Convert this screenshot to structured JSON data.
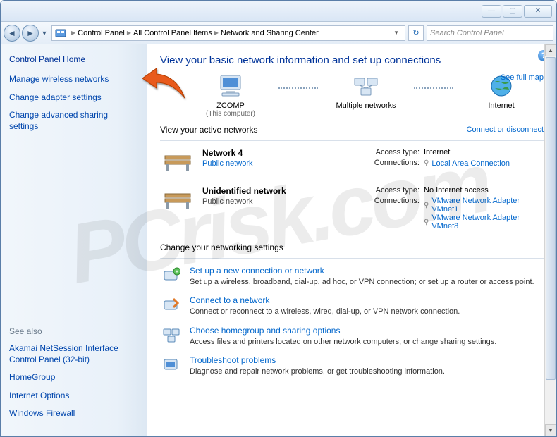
{
  "titlebar": {
    "min": "—",
    "max": "▢",
    "close": "✕"
  },
  "address": {
    "crumbs": [
      "Control Panel",
      "All Control Panel Items",
      "Network and Sharing Center"
    ]
  },
  "search": {
    "placeholder": "Search Control Panel"
  },
  "sidebar": {
    "home": "Control Panel Home",
    "links": [
      "Manage wireless networks",
      "Change adapter settings",
      "Change advanced sharing settings"
    ],
    "see_also_label": "See also",
    "see_also": [
      "Akamai NetSession Interface Control Panel (32-bit)",
      "HomeGroup",
      "Internet Options",
      "Windows Firewall"
    ]
  },
  "content": {
    "heading": "View your basic network information and set up connections",
    "full_map": "See full map",
    "nodes": {
      "computer": {
        "label": "ZCOMP",
        "sub": "(This computer)"
      },
      "multi": {
        "label": "Multiple networks",
        "sub": ""
      },
      "internet": {
        "label": "Internet",
        "sub": ""
      }
    },
    "active_label": "View your active networks",
    "connect_link": "Connect or disconnect",
    "net1": {
      "name": "Network  4",
      "type": "Public network",
      "access_label": "Access type:",
      "access_val": "Internet",
      "conn_label": "Connections:",
      "conn_val": "Local Area Connection"
    },
    "net2": {
      "name": "Unidentified network",
      "type": "Public network",
      "access_label": "Access type:",
      "access_val": "No Internet access",
      "conn_label": "Connections:",
      "conn_vals": [
        "VMware Network Adapter VMnet1",
        "VMware Network Adapter VMnet8"
      ]
    },
    "change_label": "Change your networking settings",
    "settings": [
      {
        "title": "Set up a new connection or network",
        "desc": "Set up a wireless, broadband, dial-up, ad hoc, or VPN connection; or set up a router or access point."
      },
      {
        "title": "Connect to a network",
        "desc": "Connect or reconnect to a wireless, wired, dial-up, or VPN network connection."
      },
      {
        "title": "Choose homegroup and sharing options",
        "desc": "Access files and printers located on other network computers, or change sharing settings."
      },
      {
        "title": "Troubleshoot problems",
        "desc": "Diagnose and repair network problems, or get troubleshooting information."
      }
    ]
  },
  "watermark": "PCrisk.com"
}
